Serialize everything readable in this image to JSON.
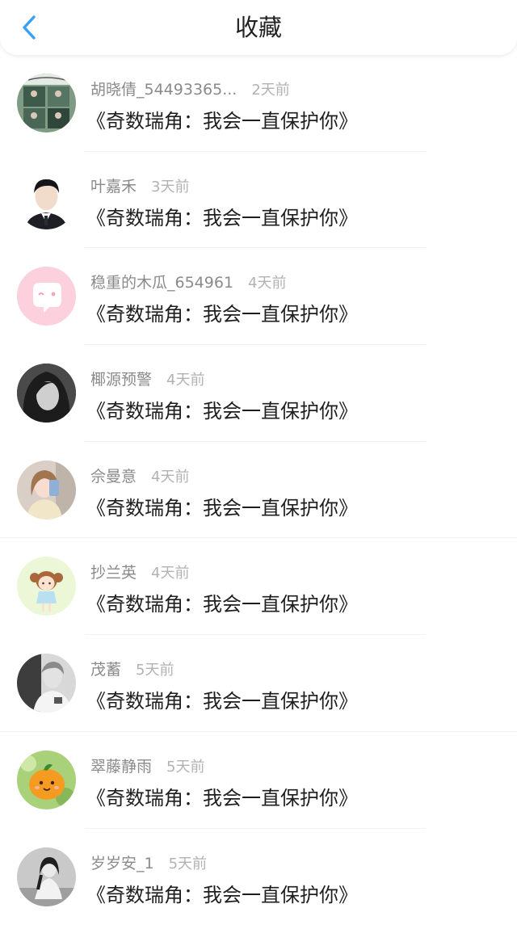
{
  "header": {
    "title": "收藏",
    "back_icon": "chevron-left-icon",
    "accent_color": "#3a9ff5"
  },
  "favorites": [
    {
      "user": "胡晓倩_54493365...",
      "time": "2天前",
      "work": "《奇数瑞角：我会一直保护你》",
      "avatar": "photo-collage-avatar"
    },
    {
      "user": "叶嘉禾",
      "time": "3天前",
      "work": "《奇数瑞角：我会一直保护你》",
      "avatar": "portrait-suit-avatar"
    },
    {
      "user": "稳重的木瓜_654961",
      "time": "4天前",
      "work": "《奇数瑞角：我会一直保护你》",
      "avatar": "pink-default-avatar"
    },
    {
      "user": "椰源预警",
      "time": "4天前",
      "work": "《奇数瑞角：我会一直保护你》",
      "avatar": "bw-portrait-avatar"
    },
    {
      "user": "佘曼意",
      "time": "4天前",
      "work": "《奇数瑞角：我会一直保护你》",
      "avatar": "selfie-avatar"
    },
    {
      "user": "抄兰英",
      "time": "4天前",
      "work": "《奇数瑞角：我会一直保护你》",
      "avatar": "cartoon-girl-avatar"
    },
    {
      "user": "茂蓄",
      "time": "5天前",
      "work": "《奇数瑞角：我会一直保护你》",
      "avatar": "bw-photo-avatar"
    },
    {
      "user": "翠藤静雨",
      "time": "5天前",
      "work": "《奇数瑞角：我会一直保护你》",
      "avatar": "orange-fruit-avatar"
    },
    {
      "user": "岁岁安_1",
      "time": "5天前",
      "work": "《奇数瑞角：我会一直保护你》",
      "avatar": "girl-sitting-avatar"
    }
  ]
}
